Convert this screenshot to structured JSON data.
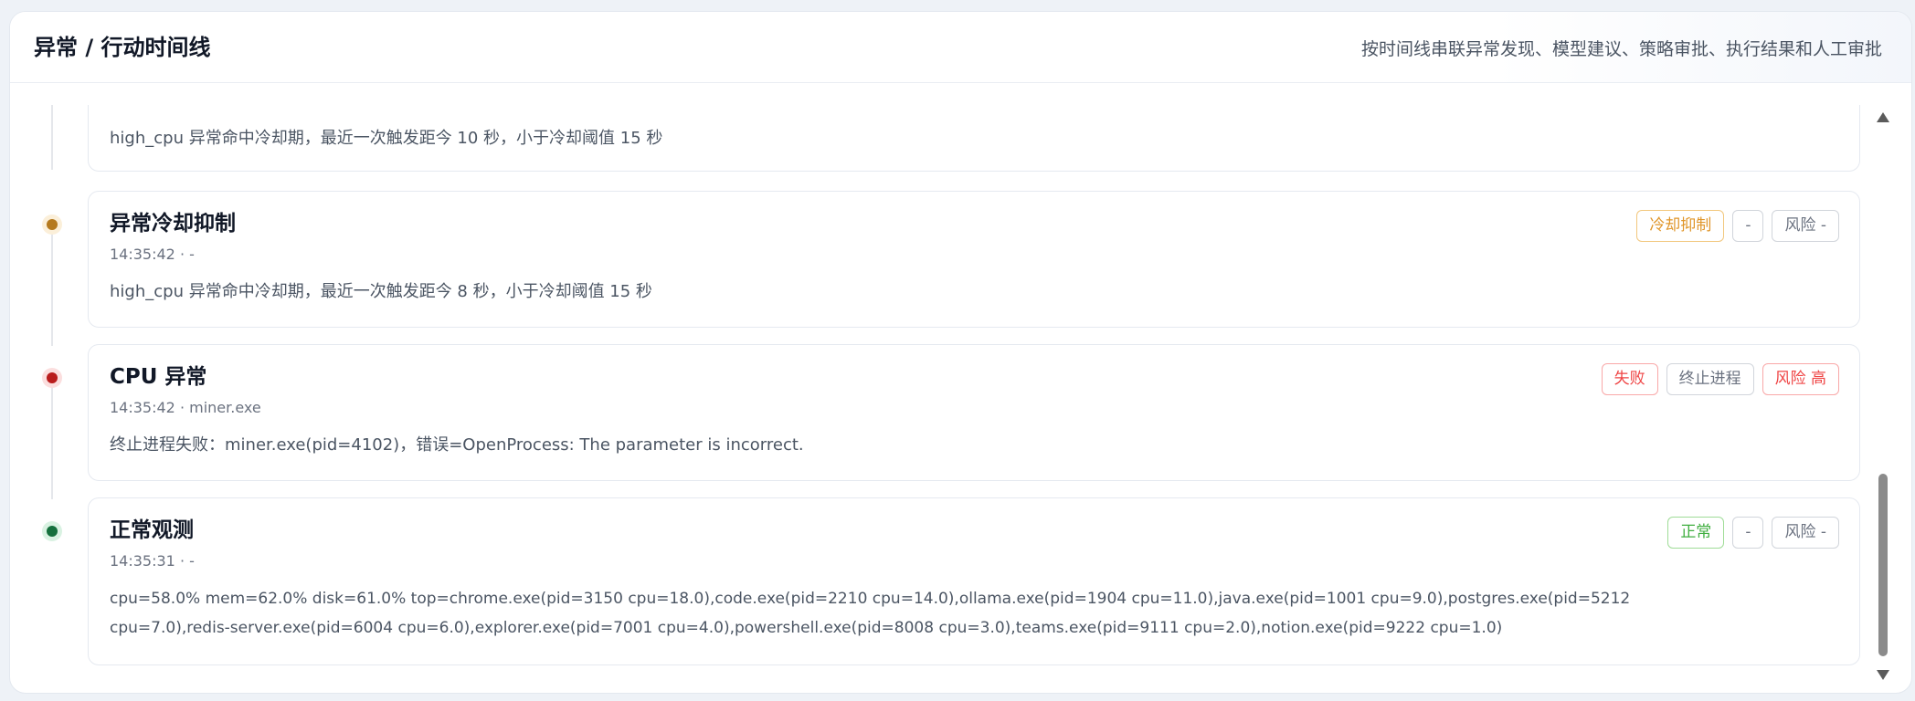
{
  "header": {
    "title": "异常 / 行动时间线",
    "subtitle": "按时间线串联异常发现、模型建议、策略审批、执行结果和人工审批"
  },
  "events": [
    {
      "detail": "high_cpu 异常命中冷却期，最近一次触发距今 10 秒，小于冷却阈值 15 秒"
    },
    {
      "title": "异常冷却抑制",
      "meta": "14:35:42 · -",
      "detail": "high_cpu 异常命中冷却期，最近一次触发距今 8 秒，小于冷却阈值 15 秒",
      "dot_color": "#b57a1f",
      "badges": [
        {
          "label": "冷却抑制",
          "color": "#e0962a"
        },
        {
          "label": "-",
          "color": "#6b7280"
        },
        {
          "label": "风险 -",
          "color": "#6b7280"
        }
      ]
    },
    {
      "title": "CPU 异常",
      "meta": "14:35:42 · miner.exe",
      "detail": "终止进程失败：miner.exe(pid=4102)，错误=OpenProcess: The parameter is incorrect.",
      "dot_color": "#b91c1c",
      "badges": [
        {
          "label": "失败",
          "color": "#ef4444"
        },
        {
          "label": "终止进程",
          "color": "#6b7280"
        },
        {
          "label": "风险 高",
          "color": "#ef4444"
        }
      ]
    },
    {
      "title": "正常观测",
      "meta": "14:35:31 · -",
      "detail": "cpu=58.0% mem=62.0% disk=61.0% top=chrome.exe(pid=3150 cpu=18.0),code.exe(pid=2210 cpu=14.0),ollama.exe(pid=1904 cpu=11.0),java.exe(pid=1001 cpu=9.0),postgres.exe(pid=5212 cpu=7.0),redis-server.exe(pid=6004 cpu=6.0),explorer.exe(pid=7001 cpu=4.0),powershell.exe(pid=8008 cpu=3.0),teams.exe(pid=9111 cpu=2.0),notion.exe(pid=9222 cpu=1.0)",
      "dot_color": "#15703d",
      "badges": [
        {
          "label": "正常",
          "color": "#3fae3f"
        },
        {
          "label": "-",
          "color": "#6b7280"
        },
        {
          "label": "风险 -",
          "color": "#6b7280"
        }
      ]
    }
  ]
}
